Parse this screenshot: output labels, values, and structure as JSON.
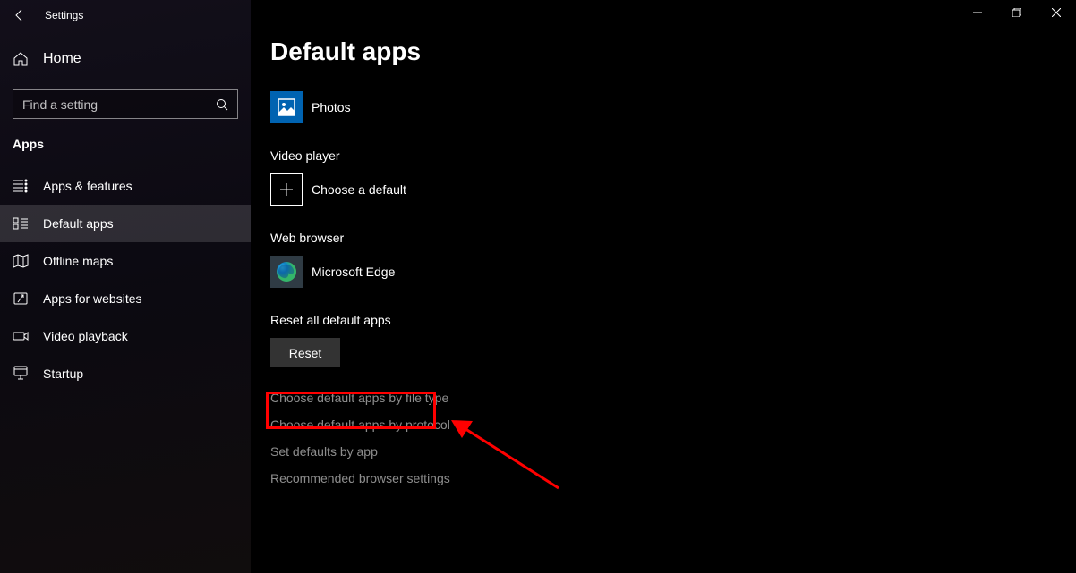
{
  "window": {
    "title": "Settings"
  },
  "sidebar": {
    "home": "Home",
    "search_placeholder": "Find a setting",
    "category": "Apps",
    "items": [
      {
        "label": "Apps & features",
        "icon": "apps-features-icon"
      },
      {
        "label": "Default apps",
        "icon": "default-apps-icon"
      },
      {
        "label": "Offline maps",
        "icon": "offline-maps-icon"
      },
      {
        "label": "Apps for websites",
        "icon": "apps-websites-icon"
      },
      {
        "label": "Video playback",
        "icon": "video-playback-icon"
      },
      {
        "label": "Startup",
        "icon": "startup-icon"
      }
    ],
    "active_index": 1
  },
  "main": {
    "heading": "Default apps",
    "photos": {
      "name": "Photos"
    },
    "video_player": {
      "label": "Video player",
      "action": "Choose a default"
    },
    "web_browser": {
      "label": "Web browser",
      "app": "Microsoft Edge"
    },
    "reset": {
      "label": "Reset all default apps",
      "button": "Reset"
    },
    "links": [
      "Choose default apps by file type",
      "Choose default apps by protocol",
      "Set defaults by app",
      "Recommended browser settings"
    ]
  },
  "annotation": {
    "highlighted_link_index": 0
  }
}
